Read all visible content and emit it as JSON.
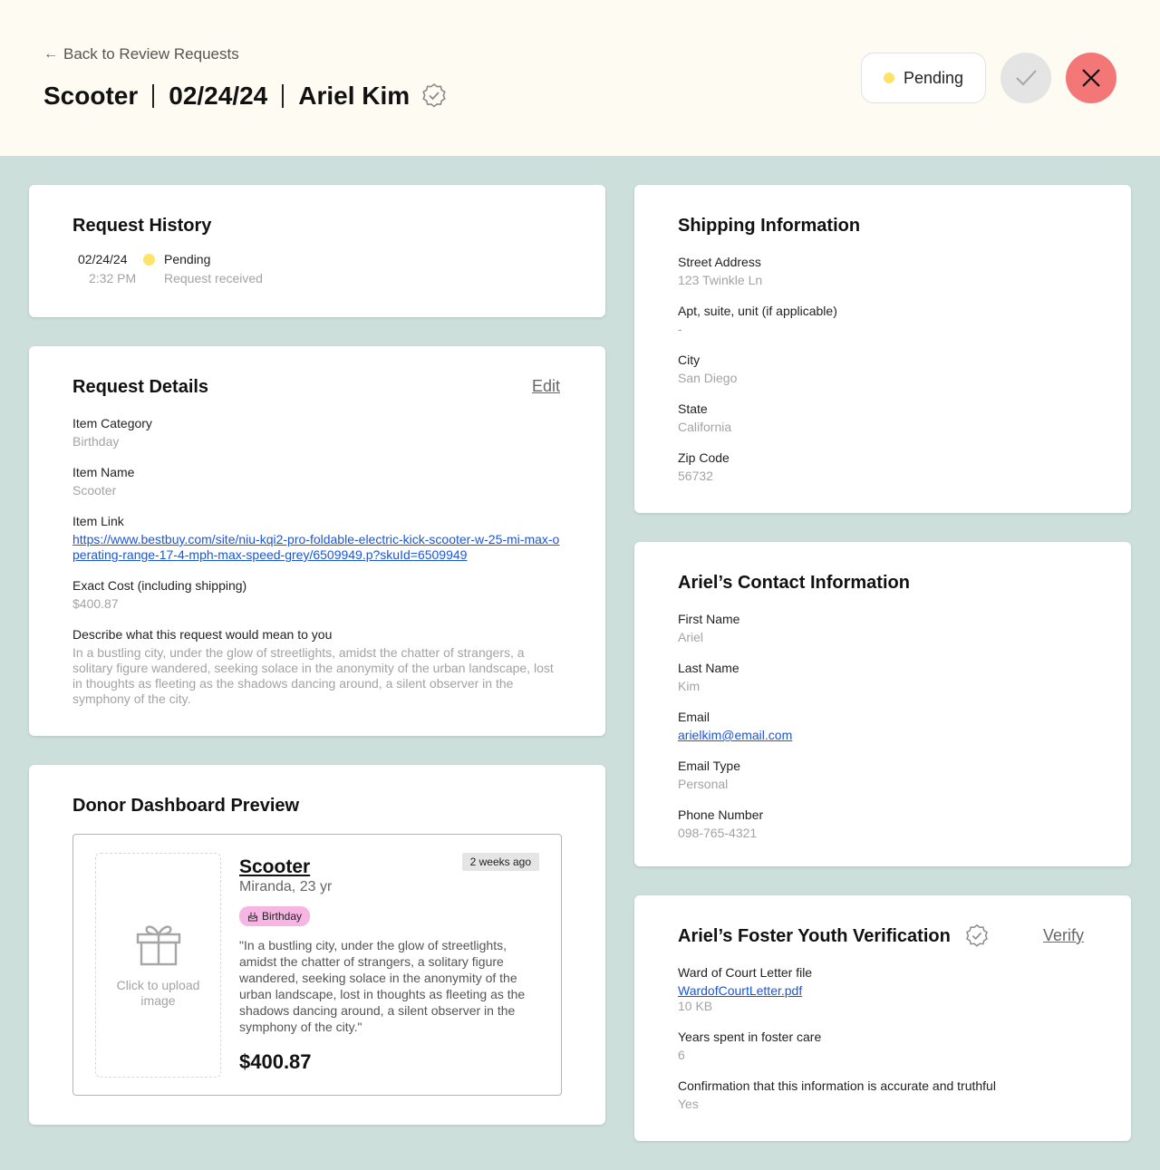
{
  "header": {
    "back_label": "Back to Review Requests",
    "item": "Scooter",
    "date": "02/24/24",
    "requester": "Ariel Kim",
    "status": "Pending",
    "colors": {
      "background": "#fefbf2",
      "pending_dot": "#fde36a",
      "reject": "#f47777",
      "approve": "#e4e4e4"
    }
  },
  "history": {
    "title": "Request History",
    "entries": [
      {
        "date": "02/24/24",
        "time": "2:32 PM",
        "status": "Pending",
        "note": "Request received"
      }
    ]
  },
  "details": {
    "title": "Request Details",
    "edit_label": "Edit",
    "category_label": "Item Category",
    "category": "Birthday",
    "name_label": "Item Name",
    "name": "Scooter",
    "link_label": "Item Link",
    "link": "https://www.bestbuy.com/site/niu-kqi2-pro-foldable-electric-kick-scooter-w-25-mi-max-operating-range-17-4-mph-max-speed-grey/6509949.p?skuId=6509949",
    "cost_label": "Exact Cost (including shipping)",
    "cost": "$400.87",
    "meaning_label": "Describe what this request would mean to you",
    "meaning": "In a bustling city, under the glow of streetlights, amidst the chatter of strangers, a solitary figure wandered, seeking solace in the anonymity of the urban landscape, lost in thoughts as fleeting as the shadows dancing around, a silent observer in the symphony of the city."
  },
  "preview": {
    "title": "Donor Dashboard Preview",
    "upload_text": "Click to upload image",
    "item_title": "Scooter",
    "subtitle": "Miranda, 23 yr",
    "time_ago": "2 weeks ago",
    "badge": "Birthday",
    "quote": "\"In a bustling city, under the glow of streetlights, amidst the chatter of strangers, a solitary figure wandered, seeking solace in the anonymity of the urban landscape, lost in thoughts as fleeting as the shadows dancing around, a silent observer in the symphony of the city.\"",
    "price": "$400.87",
    "badge_color": "#f7b5e3"
  },
  "shipping": {
    "title": "Shipping Information",
    "fields": [
      {
        "label": "Street Address",
        "value": "123 Twinkle Ln"
      },
      {
        "label": "Apt, suite, unit (if applicable)",
        "value": "-"
      },
      {
        "label": "City",
        "value": "San Diego"
      },
      {
        "label": "State",
        "value": "California"
      },
      {
        "label": "Zip Code",
        "value": "56732"
      }
    ]
  },
  "contact": {
    "title": "Ariel’s Contact Information",
    "first_label": "First Name",
    "first": "Ariel",
    "last_label": "Last Name",
    "last": "Kim",
    "email_label": "Email",
    "email": "arielkim@email.com",
    "email_type_label": "Email Type",
    "email_type": "Personal",
    "phone_label": "Phone Number",
    "phone": "098-765-4321"
  },
  "verification": {
    "title": "Ariel’s Foster Youth Verification",
    "verify_label": "Verify",
    "letter_label": "Ward of Court Letter file",
    "letter_file": "WardofCourtLetter.pdf",
    "letter_size": "10 KB",
    "years_label": "Years spent in foster care",
    "years": "6",
    "confirm_label": "Confirmation that this information is accurate and truthful",
    "confirm": "Yes"
  }
}
